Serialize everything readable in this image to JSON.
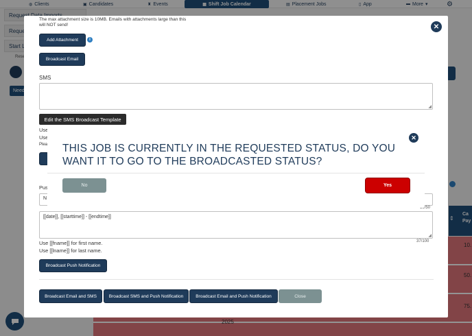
{
  "nav": {
    "items": [
      {
        "label": "Clients",
        "icon": "globe-icon"
      },
      {
        "label": "Candidates",
        "icon": "briefcase-icon"
      },
      {
        "label": "Events",
        "icon": "trophy-icon"
      },
      {
        "label": "Shift Job Calendar",
        "icon": "calendar-icon"
      },
      {
        "label": "Placement Jobs",
        "icon": "folder-icon"
      },
      {
        "label": "App",
        "icon": "phone-icon"
      },
      {
        "label": "More",
        "icon": "chat-icon"
      }
    ]
  },
  "sidebar": {
    "items": [
      {
        "label": "Request Data Imports"
      },
      {
        "label": "Reque"
      },
      {
        "label": "Start L"
      }
    ],
    "small_text": "Rese",
    "need_button": "Need"
  },
  "table": {
    "header": "Ca Pay",
    "values": [
      "10.",
      "50.",
      "75."
    ],
    "year": "2025"
  },
  "modal": {
    "attachment_note": "The max attachment size is 10MB. Emails with attachments large than this will NOT send!",
    "add_attachment": "Add Attachment",
    "broadcast_email": "Broadcast Email",
    "sms_label": "SMS",
    "edit_template": "Edit the SMS Broadcast Template",
    "partial_use_1": "Use",
    "partial_use_2": "Use",
    "partial_please": "Plea",
    "partial_push": "Pus",
    "partial_n": "N",
    "push_counter": "19/50",
    "push_message": "[[date]], [[starttime]] - [[endtime]]",
    "message_counter": "37/100",
    "hint_fname": "Use [[fname]] for first name.",
    "hint_lname": "Use [[lname]] for last name.",
    "broadcast_push": "Broadcast Push Notification",
    "footer": {
      "email_sms": "Broadcast Email and SMS",
      "sms_push": "Broadcast SMS and Push Notification",
      "email_push": "Broadcast Email and Push Notification",
      "close": "Close"
    }
  },
  "confirm": {
    "message": "THIS JOB IS CURRENTLY IN THE REQUESTED STATUS, DO YOU WANT IT TO GO TO THE BROADCASTED STATUS?",
    "no": "No",
    "yes": "Yes"
  },
  "colors": {
    "navy": "#1f3b5a",
    "primary_blue": "#1f4e79",
    "danger": "#cc0000",
    "muted": "#7c9192",
    "row_highlight": "#e0757a"
  }
}
